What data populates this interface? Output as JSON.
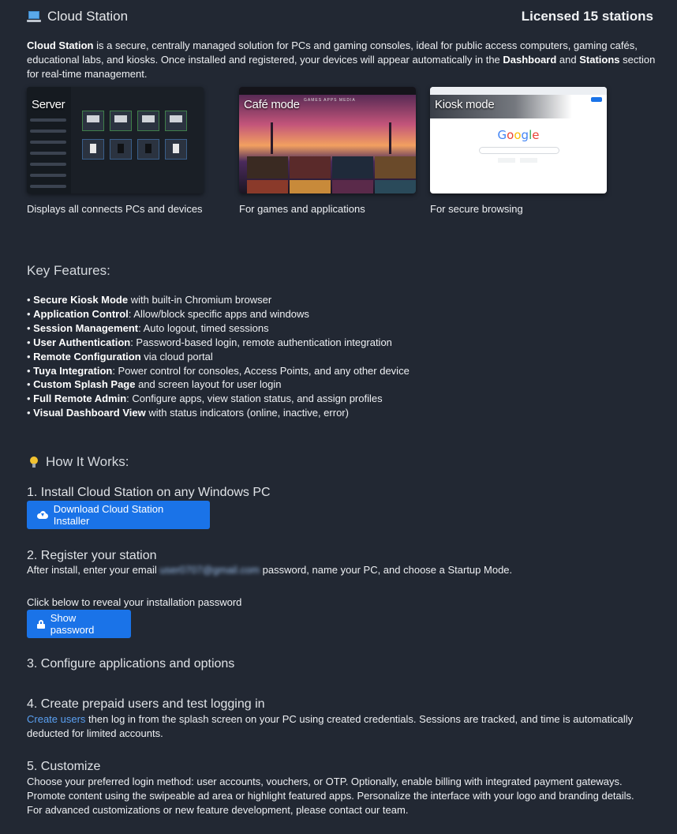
{
  "header": {
    "app_icon": "laptop-icon",
    "title": "Cloud Station",
    "licensed": "Licensed 15 stations"
  },
  "intro": {
    "brand": "Cloud Station",
    "text1": " is a secure, centrally managed solution for PCs and gaming consoles, ideal for public access computers, gaming cafés, educational labs, and kiosks. Once installed and registered, your devices will appear automatically in the ",
    "dashboard": "Dashboard",
    "and": " and ",
    "stations": "Stations",
    "text2": " section for real-time management."
  },
  "cards": [
    {
      "label": "Server",
      "caption": "Displays all connects PCs and devices"
    },
    {
      "label": "Café mode",
      "caption": "For games and applications",
      "tabs": "GAMES  APPS  MEDIA"
    },
    {
      "label": "Kiosk mode",
      "caption": "For secure browsing",
      "logo": "Google"
    }
  ],
  "features": {
    "heading": "Key Features:",
    "items": [
      {
        "bold": "Secure Kiosk Mode",
        "rest": " with built-in Chromium browser"
      },
      {
        "bold": "Application Control",
        "rest": ": Allow/block specific apps and windows"
      },
      {
        "bold": "Session Management",
        "rest": ": Auto logout, timed sessions"
      },
      {
        "bold": "User Authentication",
        "rest": ": Password-based login, remote authentication integration"
      },
      {
        "bold": "Remote Configuration",
        "rest": " via cloud portal"
      },
      {
        "bold": "Tuya Integration",
        "rest": ": Power control for consoles, Access Points, and any other device"
      },
      {
        "bold": "Custom Splash Page",
        "rest": " and screen layout for user login"
      },
      {
        "bold": "Full Remote Admin",
        "rest": ": Configure apps, view station status, and assign profiles"
      },
      {
        "bold": "Visual Dashboard View",
        "rest": " with status indicators (online, inactive, error)"
      }
    ]
  },
  "how": {
    "heading": "How It Works:",
    "icon": "lightbulb-icon",
    "step1": "1. Install Cloud Station on any Windows PC",
    "download_button": "Download Cloud Station Installer",
    "step2": "2. Register your station",
    "step2_text_a": "After install, enter your email ",
    "step2_email": "user0707@gmail.com",
    "step2_text_b": " password, name your PC, and choose a Startup Mode.",
    "reveal_text": "Click below to reveal your installation password",
    "show_password_button": "Show password",
    "step3": "3. Configure applications and options",
    "step4": "4. Create prepaid users and test logging in",
    "step4_link": "Create users",
    "step4_text": " then log in from the splash screen on your PC using created credentials. Sessions are tracked, and time is automatically deducted for limited accounts.",
    "step5": "5. Customize",
    "step5_text": "Choose your preferred login method: user accounts, vouchers, or OTP. Optionally, enable billing with integrated payment gateways. Promote content using the swipeable ad area or highlight featured apps. Personalize the interface with your logo and branding details.",
    "step5_text2": "For advanced customizations or new feature development, please contact our team."
  },
  "colors": {
    "background": "#222833",
    "accent": "#1a73e8",
    "link": "#5aa0f2"
  }
}
